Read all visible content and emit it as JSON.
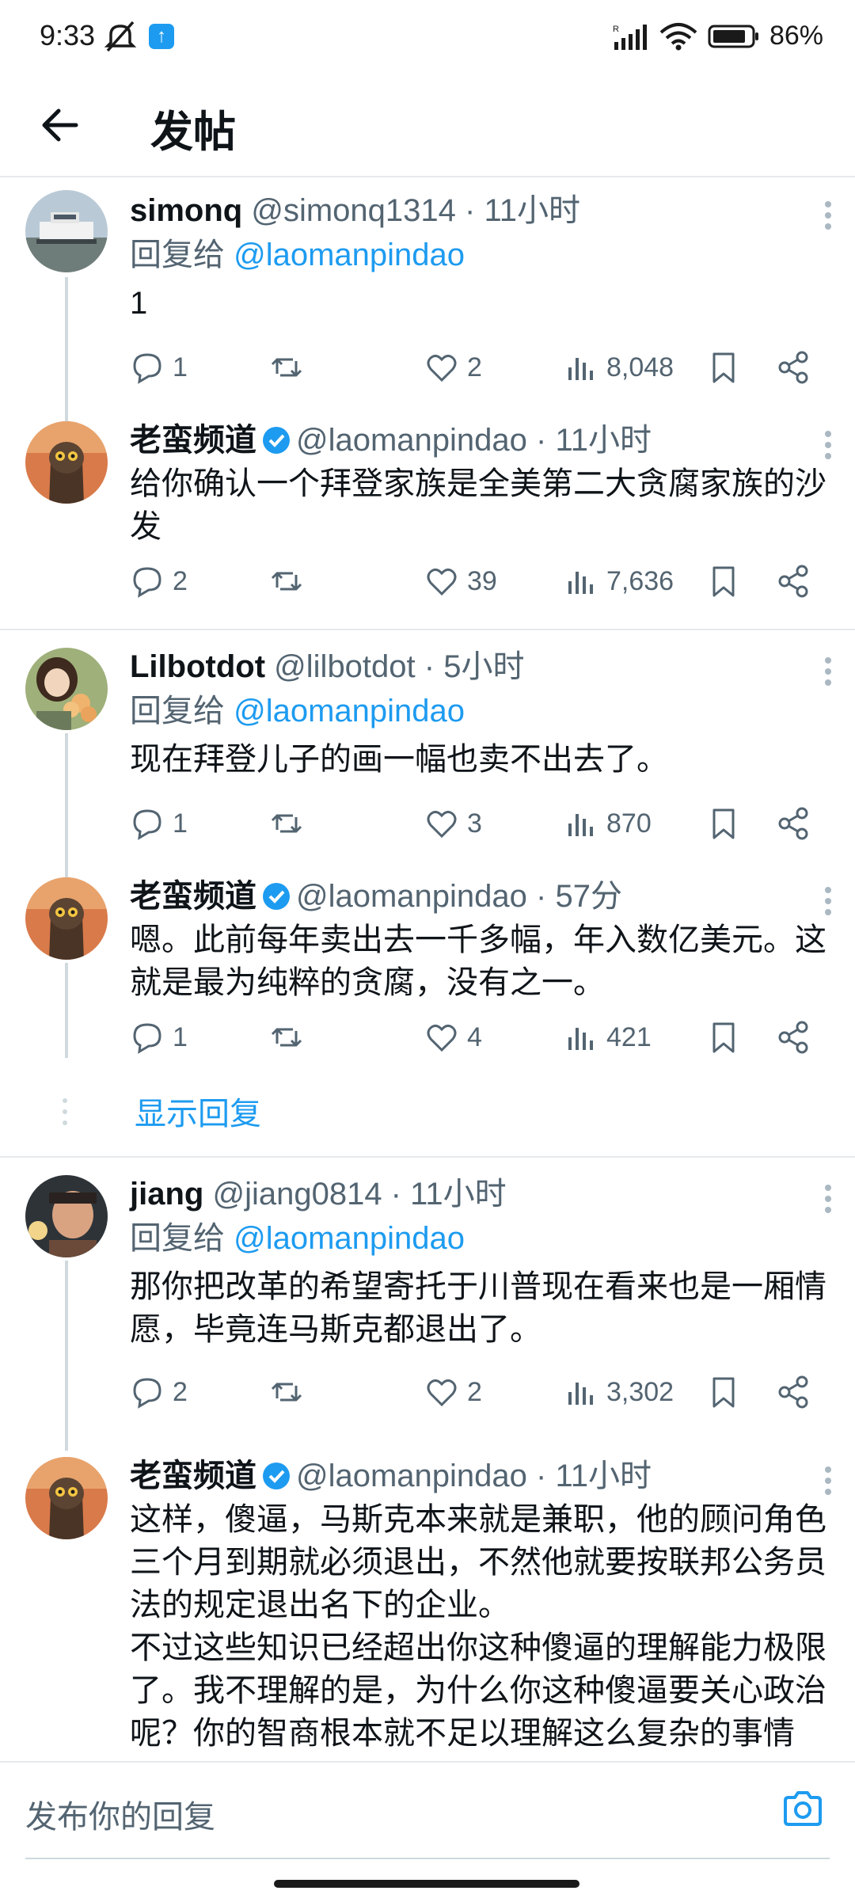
{
  "status_bar": {
    "time": "9:33",
    "notif_icon": "↑",
    "battery": "86%"
  },
  "header": {
    "title": "发帖"
  },
  "tweets": [
    {
      "name": "simonq",
      "handle": "@simonq1314 · 11小时",
      "reply_to_prefix": "回复给 ",
      "reply_to": "@laomanpindao",
      "text": "1",
      "replies": "1",
      "likes": "2",
      "views": "8,048",
      "avatar": "boat"
    },
    {
      "name": "老蛮频道",
      "handle": "@laomanpindao · 11小时",
      "text": "给你确认一个拜登家族是全美第二大贪腐家族的沙发",
      "replies": "2",
      "likes": "39",
      "views": "7,636",
      "avatar": "owl"
    },
    {
      "name": "Lilbotdot",
      "handle": "@lilbotdot · 5小时",
      "reply_to_prefix": "回复给 ",
      "reply_to": "@laomanpindao",
      "text": "现在拜登儿子的画一幅也卖不出去了。",
      "replies": "1",
      "likes": "3",
      "views": "870",
      "avatar": "girl"
    },
    {
      "name": "老蛮频道",
      "handle": "@laomanpindao · 57分",
      "text": "嗯。此前每年卖出去一千多幅，年入数亿美元。这就是最为纯粹的贪腐，没有之一。",
      "replies": "1",
      "likes": "4",
      "views": "421",
      "avatar": "owl"
    },
    {
      "name": "jiang",
      "handle": "@jiang0814 · 11小时",
      "reply_to_prefix": "回复给 ",
      "reply_to": "@laomanpindao",
      "text": "那你把改革的希望寄托于川普现在看来也是一厢情愿，毕竟连马斯克都退出了。",
      "replies": "2",
      "likes": "2",
      "views": "3,302",
      "avatar": "man"
    },
    {
      "name": "老蛮频道",
      "handle": "@laomanpindao · 11小时",
      "text": "这样，傻逼，马斯克本来就是兼职，他的顾问角色三个月到期就必须退出，不然他就要按联邦公务员法的规定退出名下的企业。\n不过这些知识已经超出你这种傻逼的理解能力极限了。我不理解的是，为什么你这种傻逼要关心政治呢？你的智商根本就不足以理解这么复杂的事情吧。",
      "avatar": "owl"
    }
  ],
  "show_replies": "显示回复",
  "composer": {
    "placeholder": "发布你的回复"
  },
  "colors": {
    "accent": "#1d9bf0",
    "muted": "#536471",
    "text": "#0f1419"
  }
}
